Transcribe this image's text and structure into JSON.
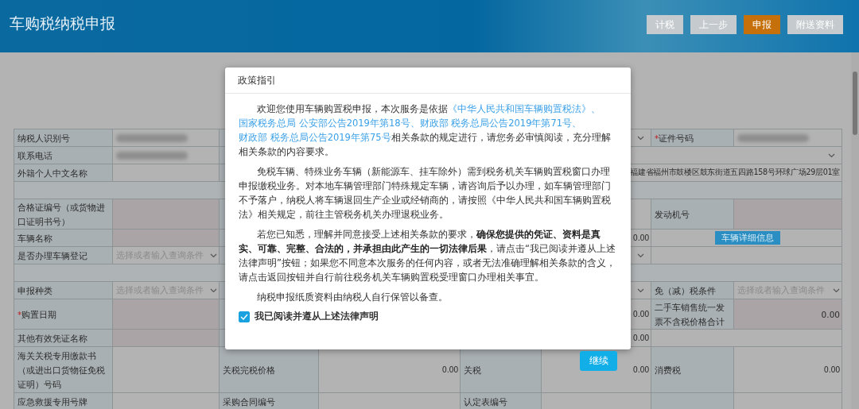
{
  "header": {
    "title": "车购税纳税申报",
    "buttons": [
      {
        "label": "计税",
        "selected": false
      },
      {
        "label": "上一步",
        "selected": false
      },
      {
        "label": "申报",
        "selected": true
      },
      {
        "label": "附送资料",
        "selected": false
      }
    ]
  },
  "form": {
    "rows": [
      {
        "cells": [
          {
            "kind": "label",
            "text": "纳税人识别号"
          },
          {
            "kind": "blurred"
          },
          {
            "kind": "label"
          },
          {
            "kind": "input"
          },
          {
            "kind": "label"
          },
          {
            "kind": "select"
          },
          {
            "kind": "label",
            "mark": "*",
            "text": "证件号码"
          },
          {
            "kind": "blurred"
          }
        ]
      },
      {
        "cells": [
          {
            "kind": "label",
            "text": "联系电话"
          },
          {
            "kind": "blurred"
          },
          {
            "kind": "label"
          },
          {
            "kind": "input"
          },
          {
            "kind": "label"
          },
          {
            "kind": "select"
          }
        ]
      },
      {
        "cells": [
          {
            "kind": "label",
            "text": "外籍个人中文名称"
          },
          {
            "kind": "input"
          },
          {
            "kind": "label"
          },
          {
            "kind": "input"
          },
          {
            "kind": "label"
          },
          {
            "kind": "input",
            "text": "福建省福州市鼓楼区鼓东街道五四路158号环球广场29层01室"
          }
        ]
      },
      {
        "cells": [
          {
            "kind": "blank"
          }
        ]
      },
      {
        "cells": [
          {
            "kind": "label",
            "text": "合格证编号（或货物进口证明书号）"
          },
          {
            "kind": "readonly"
          },
          {
            "kind": "label"
          },
          {
            "kind": "input"
          },
          {
            "kind": "label"
          },
          {
            "kind": "input"
          },
          {
            "kind": "label",
            "text": "发动机号"
          },
          {
            "kind": "readonly"
          }
        ]
      },
      {
        "cells": [
          {
            "kind": "label",
            "text": "车辆名称"
          },
          {
            "kind": "readonly"
          },
          {
            "kind": "label"
          },
          {
            "kind": "input"
          },
          {
            "kind": "label"
          },
          {
            "kind": "input",
            "text": "0.00"
          },
          {
            "kind": "button",
            "text": "车辆详细信息"
          }
        ]
      },
      {
        "cells": [
          {
            "kind": "label",
            "text": "是否办理车辆登记"
          },
          {
            "kind": "select",
            "placeholder": "选择或者输入查询条件"
          },
          {
            "kind": "label"
          },
          {
            "kind": "input"
          },
          {
            "kind": "label"
          },
          {
            "kind": "select"
          },
          {
            "kind": "input"
          }
        ]
      },
      {
        "cells": [
          {
            "kind": "blank"
          }
        ]
      },
      {
        "cells": [
          {
            "kind": "label",
            "text": "申报种类"
          },
          {
            "kind": "select",
            "placeholder": "选择或者输入查询条件"
          },
          {
            "kind": "label"
          },
          {
            "kind": "input"
          },
          {
            "kind": "label"
          },
          {
            "kind": "select"
          },
          {
            "kind": "label",
            "text": "免（减）税条件"
          },
          {
            "kind": "select",
            "placeholder": "选择或者输入查询条件"
          }
        ]
      },
      {
        "cells": [
          {
            "kind": "label",
            "mark": "*",
            "text": "购置日期"
          },
          {
            "kind": "readonly"
          },
          {
            "kind": "label"
          },
          {
            "kind": "input"
          },
          {
            "kind": "label"
          },
          {
            "kind": "input",
            "text": "0.00"
          },
          {
            "kind": "label",
            "text": "二手车销售统一发票不含税价格合计"
          },
          {
            "kind": "readonly",
            "text": "0.00"
          }
        ]
      },
      {
        "cells": [
          {
            "kind": "label",
            "text": "其他有效凭证名称"
          },
          {
            "kind": "readonly"
          },
          {
            "kind": "label"
          },
          {
            "kind": "input"
          },
          {
            "kind": "label"
          },
          {
            "kind": "input",
            "text": "0.00"
          },
          {
            "kind": "input"
          }
        ]
      },
      {
        "cells": [
          {
            "kind": "label",
            "text": "海关关税专用缴款书（或进出口货物征免税证明）号码"
          },
          {
            "kind": "input"
          },
          {
            "kind": "label",
            "text": "关税完税价格"
          },
          {
            "kind": "input",
            "text": "0.00"
          },
          {
            "kind": "label",
            "text": "关税"
          },
          {
            "kind": "input",
            "text": "0.00"
          },
          {
            "kind": "label",
            "text": "消费税"
          },
          {
            "kind": "input",
            "text": "0.00"
          }
        ]
      },
      {
        "cells": [
          {
            "kind": "label",
            "text": "应急救援专用号牌"
          },
          {
            "kind": "input"
          },
          {
            "kind": "label",
            "text": "采购合同编号"
          },
          {
            "kind": "input"
          },
          {
            "kind": "label",
            "text": "认定表编号"
          },
          {
            "kind": "input"
          },
          {
            "kind": "label"
          },
          {
            "kind": "input"
          }
        ]
      }
    ]
  },
  "dialog": {
    "title": "政策指引",
    "paragraphs": [
      [
        {
          "kind": "text",
          "text": "欢迎您使用车辆购置税申报，本次服务是依据"
        },
        {
          "kind": "link",
          "text": "《中华人民共和国车辆购置税法》、"
        },
        {
          "kind": "link",
          "text": "国家税务总局 公安部公告2019年第18号、"
        },
        {
          "kind": "link",
          "text": "财政部 税务总局公告2019年第71号、"
        },
        {
          "kind": "link",
          "text": "财政部 税务总局公告2019年第75号"
        },
        {
          "kind": "text",
          "text": "相关条款的规定进行，请您务必审慎阅读，充分理解相关条款的内容要求。"
        }
      ],
      [
        {
          "kind": "text",
          "text": "免税车辆、特殊业务车辆（新能源车、挂车除外）需到税务机关车辆购置税窗口办理申报缴税业务。对本地车辆管理部门特殊规定车辆，请咨询后予以办理，如车辆管理部门不予落户，纳税人将车辆退回生产企业或经销商的，请按照《中华人民共和国车辆购置税法》相关规定，前往主管税务机关办理退税业务。"
        }
      ],
      [
        {
          "kind": "text",
          "text": "若您已知悉，理解并同意接受上述相关条款的要求，**确保您提供的凭证、资料是真实、可靠、完整、合法的，并承担由此产生的一切法律后果**，请点击“我已阅读并遵从上述法律声明”按钮；如果您不同意本次服务的任何内容，或者无法准确理解相关条款的含义，请点击返回按钮并自行前往税务机关车辆购置税受理窗口办理相关事宜。"
        }
      ],
      [
        {
          "kind": "text",
          "text": "纳税申报纸质资料由纳税人自行保管以备查。"
        }
      ]
    ],
    "agree": {
      "label": "我已阅读并遵从上述法律声明",
      "checked": true
    },
    "button": "继续"
  }
}
